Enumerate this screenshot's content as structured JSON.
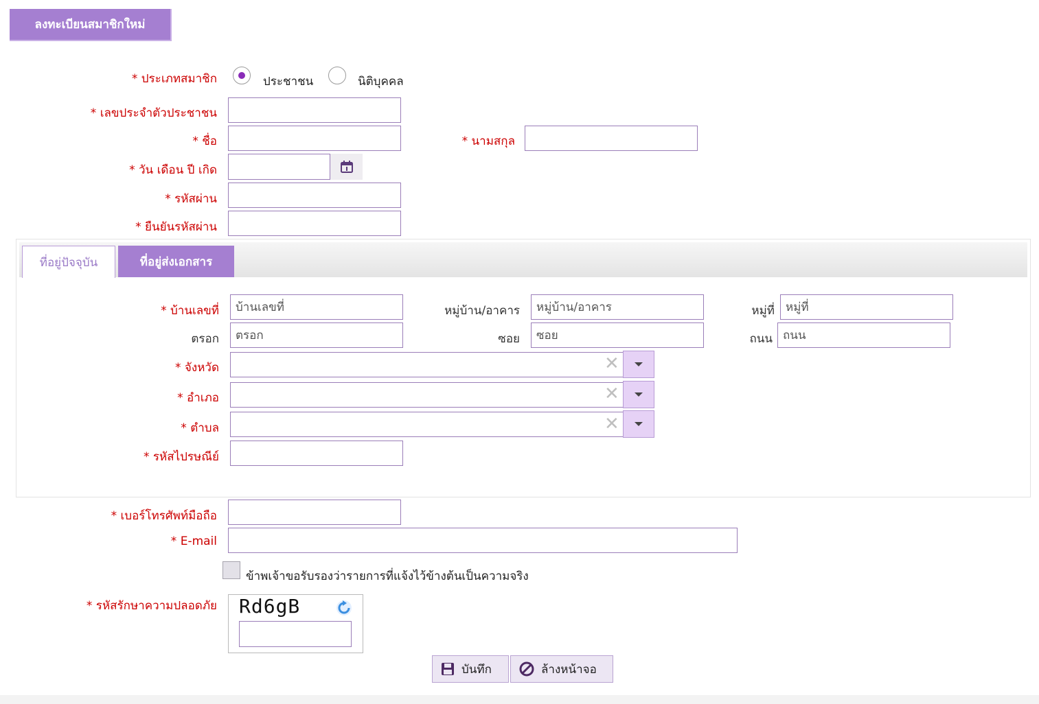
{
  "header": {
    "title": "ลงทะเบียนสมาชิกใหม่"
  },
  "member_type": {
    "label": "* ประเภทสมาชิก",
    "options": [
      {
        "label": "ประชาชน",
        "selected": true
      },
      {
        "label": "นิติบุคคล",
        "selected": false
      }
    ]
  },
  "fields": {
    "citizen_id": {
      "label": "* เลขประจำตัวประชาชน",
      "value": ""
    },
    "first_name": {
      "label": "* ชื่อ",
      "value": ""
    },
    "last_name": {
      "label": "* นามสกุล",
      "value": ""
    },
    "birth_date": {
      "label": "* วัน เดือน ปี เกิด",
      "value": ""
    },
    "password": {
      "label": "* รหัสผ่าน",
      "value": ""
    },
    "confirm_password": {
      "label": "* ยืนยันรหัสผ่าน",
      "value": ""
    }
  },
  "tabs": [
    {
      "label": "ที่อยู่ปัจจุบัน",
      "active": false
    },
    {
      "label": "ที่อยู่ส่งเอกสาร",
      "active": true
    }
  ],
  "address": {
    "house_no": {
      "label": "* บ้านเลขที่",
      "placeholder": "บ้านเลขที่"
    },
    "village": {
      "label": "หมู่บ้าน/อาคาร",
      "placeholder": "หมู่บ้าน/อาคาร"
    },
    "moo": {
      "label": "หมู่ที่",
      "placeholder": "หมู่ที่"
    },
    "trok": {
      "label": "ตรอก",
      "placeholder": "ตรอก"
    },
    "soi": {
      "label": "ซอย",
      "placeholder": "ซอย"
    },
    "road": {
      "label": "ถนน",
      "placeholder": "ถนน"
    },
    "province": {
      "label": "* จังหวัด",
      "value": ""
    },
    "district": {
      "label": "* อำเภอ",
      "value": ""
    },
    "subdistrict": {
      "label": "* ตำบล",
      "value": ""
    },
    "postcode": {
      "label": "* รหัสไปรษณีย์",
      "value": ""
    },
    "clear_symbol": "✕"
  },
  "contact": {
    "mobile": {
      "label": "* เบอร์โทรศัพท์มือถือ",
      "value": ""
    },
    "email": {
      "label": "* E-mail",
      "value": ""
    }
  },
  "certify": {
    "label": "ข้าพเจ้าขอรับรองว่ารายการที่แจ้งไว้ข้างต้นเป็นความจริง",
    "checked": false
  },
  "captcha": {
    "label": "* รหัสรักษาความปลอดภัย",
    "code": "Rd6gB",
    "value": ""
  },
  "actions": {
    "save_label": "บันทึก",
    "clear_label": "ล้างหน้าจอ"
  },
  "colors": {
    "accent": "#a57fd1",
    "required": "#cc0000",
    "input_border": "#9a7db8"
  },
  "icons": {
    "calendar": "calendar-icon",
    "refresh": "refresh-icon",
    "save": "floppy-disk-icon",
    "clear": "no-entry-icon",
    "dropdown": "caret-down-icon"
  }
}
